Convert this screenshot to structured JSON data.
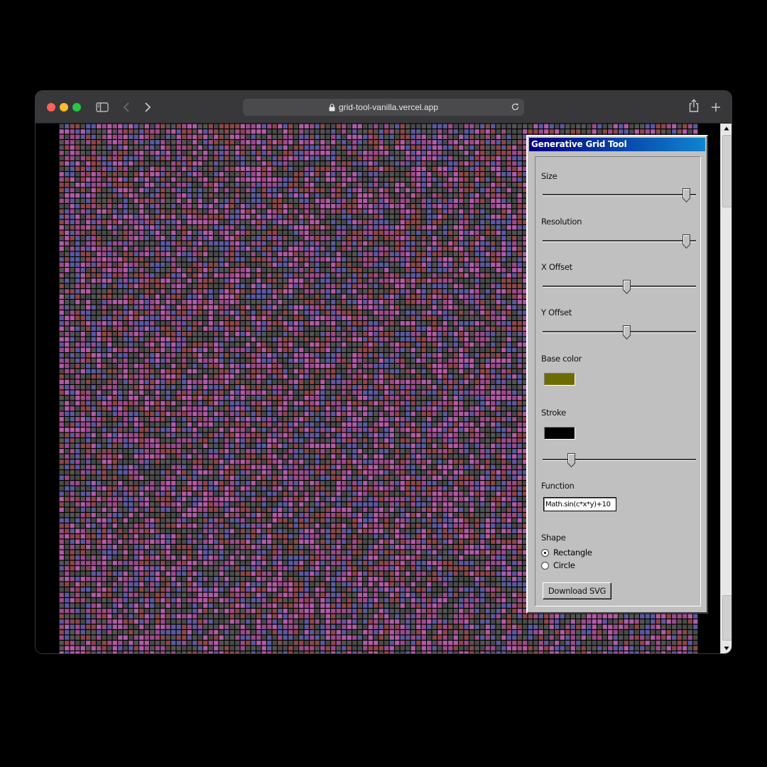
{
  "browser": {
    "url": "grid-tool-vanilla.vercel.app",
    "icons": {
      "sidebar": "sidebar-icon",
      "back": "chevron-left-icon",
      "forward": "chevron-right-icon",
      "lock": "lock-icon",
      "reload": "reload-icon",
      "share": "share-icon",
      "new_tab": "plus-icon"
    }
  },
  "grid": {
    "palette": [
      "#4a4a4a",
      "#5a5aa0",
      "#9a4c8a",
      "#8c4848",
      "#b05ca6",
      "#545454"
    ],
    "stroke_color": "#000000"
  },
  "panel": {
    "title": "Generative Grid Tool",
    "size": {
      "label": "Size",
      "value": 0.96
    },
    "resolution": {
      "label": "Resolution",
      "value": 0.96
    },
    "x_offset": {
      "label": "X Offset",
      "value": 0.55
    },
    "y_offset": {
      "label": "Y Offset",
      "value": 0.55
    },
    "base_color": {
      "label": "Base color",
      "value": "#6e6b00"
    },
    "stroke": {
      "label": "Stroke",
      "color": "#000000",
      "width": 0.17
    },
    "function": {
      "label": "Function",
      "value": "Math.sin(c*x*y)+10"
    },
    "shape": {
      "label": "Shape",
      "options": [
        {
          "label": "Rectangle",
          "checked": true
        },
        {
          "label": "Circle",
          "checked": false
        }
      ]
    },
    "download_label": "Download SVG"
  }
}
